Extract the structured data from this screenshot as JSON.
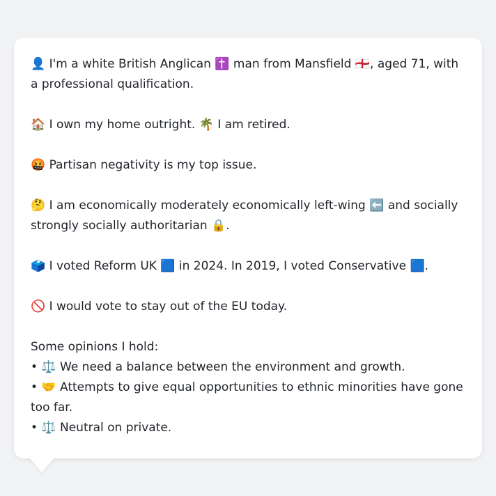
{
  "card": {
    "identity": "👤 I'm a white British Anglican ✝️ man from Mansfield 🏴󠁧󠁢󠁥󠁮󠁧󠁿, aged 71, with a professional qualification.",
    "housing": "🏠 I own my home outright. 🌴 I am retired.",
    "issue": "🤬 Partisan negativity is my top issue.",
    "ideology": "🤔 I am economically moderately economically left-wing ⬅️ and socially strongly socially authoritarian 🔒.",
    "votes": "🗳️ I voted Reform UK 🟦 in 2024. In 2019, I voted Conservative 🟦.",
    "eu": "🚫 I would vote to stay out of the EU today.",
    "opinions_heading": "Some opinions I hold:",
    "opinions": [
      "• ⚖️ We need a balance between the environment and growth.",
      "• 🤝 Attempts to give equal opportunities to ethnic minorities have gone too far.",
      "• ⚖️ Neutral on private."
    ]
  }
}
